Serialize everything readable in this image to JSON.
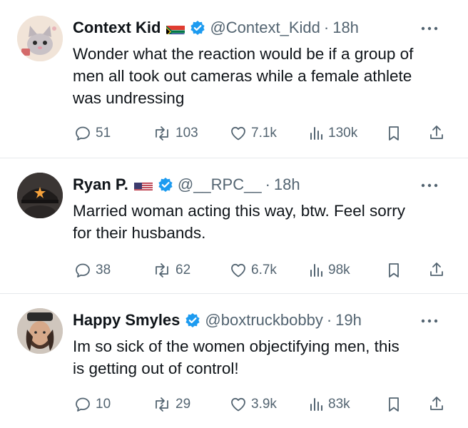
{
  "tweets": [
    {
      "name": "Context Kid",
      "flag": "south-africa-flag",
      "handle": "@Context_Kidd",
      "time": "18h",
      "text": "Wonder what the reaction would be if a group of\nmen all took out cameras while a female athlete\nwas undressing",
      "replies": "51",
      "reposts": "103",
      "likes": "7.1k",
      "views": "130k"
    },
    {
      "name": "Ryan P.",
      "flag": "usa-flag",
      "handle": "@__RPC__",
      "time": "18h",
      "text": "Married woman acting this way, btw. Feel sorry\nfor their husbands.",
      "replies": "38",
      "reposts": "62",
      "likes": "6.7k",
      "views": "98k"
    },
    {
      "name": "Happy Smyles",
      "flag": "",
      "handle": "@boxtruckbobby",
      "time": "19h",
      "text": "Im so sick of the women objectifying  men, this\nis getting out of control!",
      "replies": "10",
      "reposts": "29",
      "likes": "3.9k",
      "views": "83k"
    }
  ],
  "separator": "·",
  "colors": {
    "text": "#0f1419",
    "secondary": "#536471",
    "verified": "#1d9bf0",
    "divider": "#e6e9ec"
  },
  "icons": [
    "more-icon",
    "reply-icon",
    "repost-icon",
    "like-icon",
    "views-icon",
    "bookmark-icon",
    "share-icon",
    "verified-badge-icon"
  ]
}
